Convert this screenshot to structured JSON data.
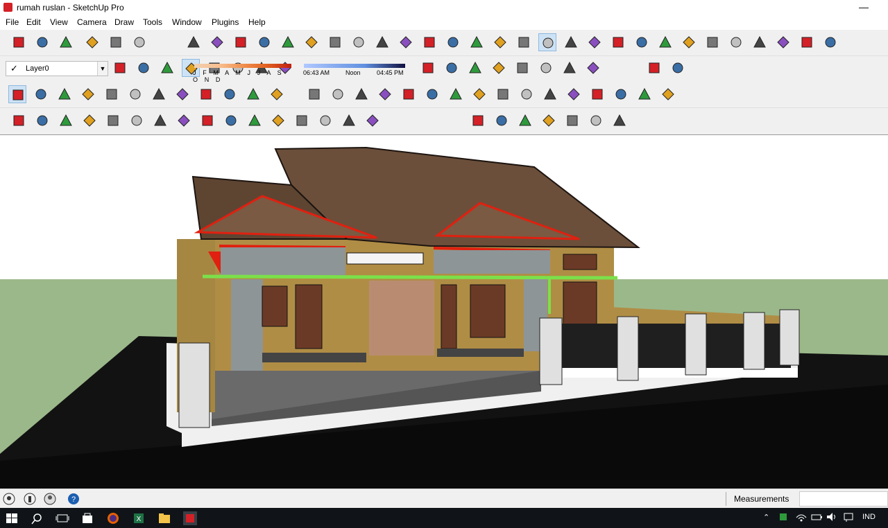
{
  "window": {
    "title": "rumah ruslan - SketchUp Pro",
    "minimize_glyph": "—"
  },
  "menu": [
    "File",
    "Edit",
    "View",
    "Camera",
    "Draw",
    "Tools",
    "Window",
    "Plugins",
    "Help"
  ],
  "layer": {
    "check_glyph": "✓",
    "current": "Layer0",
    "arrow_glyph": "▼"
  },
  "shadow": {
    "months": "J F M A M J J A S O N D",
    "time_start": "06:43 AM",
    "time_noon": "Noon",
    "time_end": "04:45 PM"
  },
  "status": {
    "measurements_label": "Measurements",
    "measurements_value": ""
  },
  "taskbar": {
    "language": "IND"
  },
  "colors": {
    "sky": "#ffffff",
    "ground": "#9bb88a",
    "roof": "#6b4f3a",
    "wall": "#b08d45",
    "accent_red": "#e02010",
    "accent_green": "#7be04a"
  },
  "icons": {
    "row1": [
      "new-icon",
      "open-icon",
      "save-icon",
      "cut-icon",
      "copy-icon",
      "paste-icon",
      "erase-icon",
      "undo-icon",
      "redo-icon",
      "print-icon",
      "model-info-icon",
      "view-iso-icon",
      "view-top-icon",
      "view-front-icon",
      "view-right-icon",
      "view-back-icon",
      "view-left-icon",
      "xray-icon",
      "back-edges-icon",
      "wireframe-icon",
      "hidden-line-icon",
      "shaded-icon",
      "shaded-texture-icon",
      "monochrome-icon",
      "component-icon",
      "section-icon",
      "house-icon",
      "warehouse-icon",
      "home-outline-icon",
      "store-icon",
      "extension-icon",
      "share-icon",
      "geo-icon",
      "photo-icon"
    ],
    "row2": [
      "layers-icon",
      "shadow-toggle-icon",
      "fog-icon",
      "orbit-icon",
      "zoom-window-icon",
      "section-plane-icon",
      "tape-icon",
      "dimension-icon",
      "protractor-icon",
      "text-icon",
      "axes-icon",
      "3d-text-icon",
      "move-icon",
      "push-pull-icon",
      "rotate-icon",
      "follow-me-icon",
      "scale-icon",
      "offset-icon"
    ],
    "row3": [
      "select-icon",
      "eraser-icon",
      "pencil-icon",
      "arc-icon",
      "rectangle-icon",
      "push-pull-icon",
      "follow-icon",
      "move-arrows-icon",
      "rotate-arrows-icon",
      "scale-box-icon",
      "tape-measure-icon",
      "text-label-icon",
      "paint-bucket-icon",
      "orbit-tool-icon",
      "pan-icon",
      "zoom-icon",
      "zoom-extents-icon",
      "walk-icon",
      "position-camera-icon",
      "look-around-icon",
      "sandbox-icon",
      "line-tool-icon",
      "freehand-icon",
      "circle-tool-icon",
      "polygon-tool-icon",
      "arc-2pt-icon",
      "pie-icon",
      "curve-icon"
    ],
    "row4": [
      "sphere-icon",
      "lamp-icon",
      "spot-icon",
      "dome-icon",
      "ball-icon",
      "sky-icon",
      "m-material-icon",
      "material-tag-icon",
      "r-render-icon",
      "rt-render-icon",
      "br-render-icon",
      "help-render-icon",
      "pencil-tag-icon",
      "ball-render-icon",
      "gold-icon",
      "plant-icon",
      "terrain-icon",
      "target-icon",
      "pause-icon",
      "export-icon",
      "import-icon",
      "stack-icon",
      "report-icon"
    ]
  }
}
